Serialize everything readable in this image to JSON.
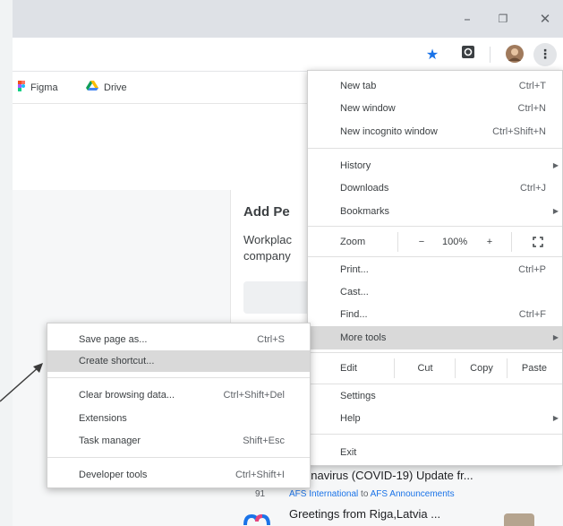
{
  "window": {
    "minimize_icon": "minimize-icon",
    "maximize_icon": "restore-icon",
    "close_icon": "close-icon"
  },
  "toolbar": {
    "bookmark_star_icon": "star-icon",
    "extension_icon": "extension-icon",
    "profile_icon": "avatar",
    "menu_icon": "more-vertical-icon"
  },
  "bookmarks": [
    {
      "label": "Figma",
      "icon": "figma-icon"
    },
    {
      "label": "Drive",
      "icon": "drive-icon"
    }
  ],
  "page": {
    "card_title": "Add Pe",
    "card_text_1": "Workplac",
    "card_text_2": "company",
    "feed_item_1": "onavirus (COVID-19) Update fr...",
    "feed_item_1_num": "91",
    "feed_item_1_meta_a": "AFS International",
    "feed_item_1_meta_to": "to",
    "feed_item_1_meta_b": "AFS Announcements",
    "feed_item_2": "Greetings from Riga,Latvia ..."
  },
  "menu": {
    "new_tab": {
      "label": "New tab",
      "shortcut": "Ctrl+T"
    },
    "new_window": {
      "label": "New window",
      "shortcut": "Ctrl+N"
    },
    "new_incognito": {
      "label": "New incognito window",
      "shortcut": "Ctrl+Shift+N"
    },
    "history": {
      "label": "History"
    },
    "downloads": {
      "label": "Downloads",
      "shortcut": "Ctrl+J"
    },
    "bookmarks": {
      "label": "Bookmarks"
    },
    "zoom": {
      "label": "Zoom",
      "minus": "−",
      "level": "100%",
      "plus": "+"
    },
    "print": {
      "label": "Print...",
      "shortcut": "Ctrl+P"
    },
    "cast": {
      "label": "Cast..."
    },
    "find": {
      "label": "Find...",
      "shortcut": "Ctrl+F"
    },
    "more_tools": {
      "label": "More tools"
    },
    "edit": {
      "label": "Edit",
      "cut": "Cut",
      "copy": "Copy",
      "paste": "Paste"
    },
    "settings": {
      "label": "Settings"
    },
    "help": {
      "label": "Help"
    },
    "exit": {
      "label": "Exit"
    }
  },
  "submenu": {
    "save_page": {
      "label": "Save page as...",
      "shortcut": "Ctrl+S"
    },
    "create_shortcut": {
      "label": "Create shortcut..."
    },
    "clear_browsing": {
      "label": "Clear browsing data...",
      "shortcut": "Ctrl+Shift+Del"
    },
    "extensions": {
      "label": "Extensions"
    },
    "task_manager": {
      "label": "Task manager",
      "shortcut": "Shift+Esc"
    },
    "developer_tools": {
      "label": "Developer tools",
      "shortcut": "Ctrl+Shift+I"
    }
  },
  "colors": {
    "star": "#1a73e8",
    "highlight": "#d9d9d9",
    "link": "#1a73e8"
  }
}
